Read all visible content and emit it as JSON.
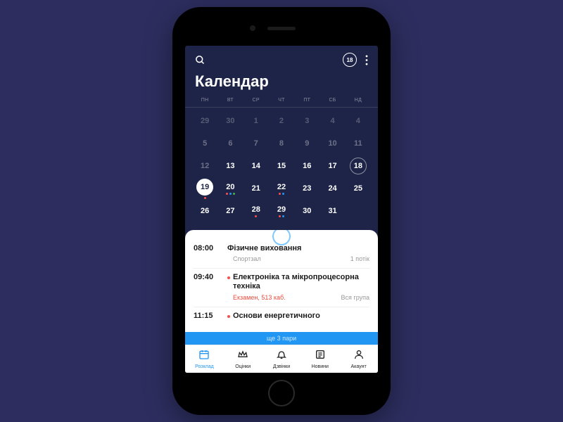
{
  "header": {
    "badge": "18",
    "title": "Календар"
  },
  "weekdays": [
    "ПН",
    "ВТ",
    "СР",
    "ЧТ",
    "ПТ",
    "СБ",
    "НД"
  ],
  "calendar": [
    [
      {
        "n": "29",
        "t": "prev"
      },
      {
        "n": "30",
        "t": "prev"
      },
      {
        "n": "1",
        "t": "prev"
      },
      {
        "n": "2",
        "t": "prev"
      },
      {
        "n": "3",
        "t": "prev"
      },
      {
        "n": "4",
        "t": "prev"
      },
      {
        "n": "4",
        "t": "prev"
      }
    ],
    [
      {
        "n": "5",
        "t": "faded"
      },
      {
        "n": "6",
        "t": "faded"
      },
      {
        "n": "7",
        "t": "faded"
      },
      {
        "n": "8",
        "t": "faded"
      },
      {
        "n": "9",
        "t": "faded"
      },
      {
        "n": "10",
        "t": "faded"
      },
      {
        "n": "11",
        "t": "faded"
      }
    ],
    [
      {
        "n": "12",
        "t": "faded"
      },
      {
        "n": "13",
        "t": ""
      },
      {
        "n": "14",
        "t": ""
      },
      {
        "n": "15",
        "t": ""
      },
      {
        "n": "16",
        "t": ""
      },
      {
        "n": "17",
        "t": ""
      },
      {
        "n": "18",
        "t": "outlined"
      }
    ],
    [
      {
        "n": "19",
        "t": "selected",
        "dots": [
          "red"
        ]
      },
      {
        "n": "20",
        "t": "",
        "dots": [
          "red",
          "blue",
          "green"
        ]
      },
      {
        "n": "21",
        "t": ""
      },
      {
        "n": "22",
        "t": "",
        "dots": [
          "red",
          "blue"
        ]
      },
      {
        "n": "23",
        "t": ""
      },
      {
        "n": "24",
        "t": ""
      },
      {
        "n": "25",
        "t": ""
      }
    ],
    [
      {
        "n": "26",
        "t": ""
      },
      {
        "n": "27",
        "t": ""
      },
      {
        "n": "28",
        "t": "",
        "dots": [
          "red"
        ]
      },
      {
        "n": "29",
        "t": "",
        "dots": [
          "red",
          "blue"
        ]
      },
      {
        "n": "30",
        "t": ""
      },
      {
        "n": "31",
        "t": ""
      },
      {
        "n": "",
        "t": ""
      }
    ]
  ],
  "events": [
    {
      "time": "08:00",
      "title": "Фізичне виховання",
      "loc": "Спортзал",
      "group": "1 потік",
      "dot": false,
      "redLoc": false
    },
    {
      "time": "09:40",
      "title": "Електроніка та мікропроцесорна техніка",
      "loc": "Екзамен, 513 каб.",
      "group": "Вся група",
      "dot": true,
      "redLoc": true
    },
    {
      "time": "11:15",
      "title": "Основи енергетичного",
      "loc": "",
      "group": "",
      "dot": true,
      "redLoc": false
    }
  ],
  "more_label": "ще 3 пари",
  "tabs": [
    {
      "label": "Розклад",
      "icon": "calendar",
      "active": true
    },
    {
      "label": "Оцінки",
      "icon": "crown",
      "active": false
    },
    {
      "label": "Дзвінки",
      "icon": "bell",
      "active": false
    },
    {
      "label": "Новини",
      "icon": "news",
      "active": false
    },
    {
      "label": "Акаунт",
      "icon": "account",
      "active": false
    }
  ]
}
